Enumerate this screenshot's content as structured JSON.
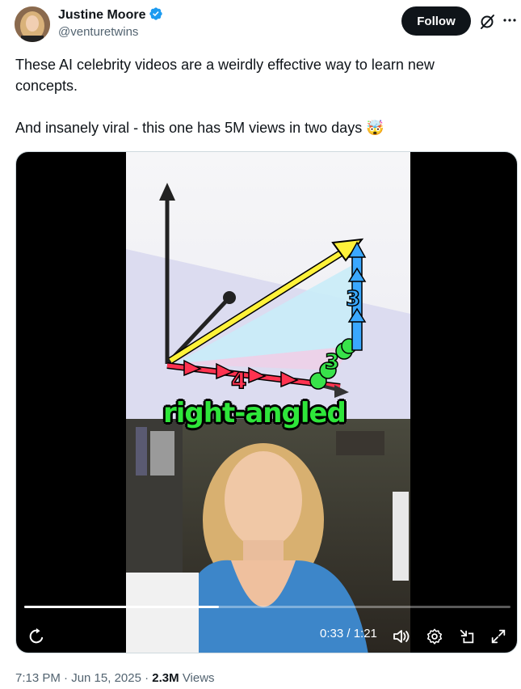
{
  "author": {
    "name": "Justine Moore",
    "handle": "@venturetwins",
    "verified_color": "#1d9bf0"
  },
  "actions": {
    "follow_label": "Follow",
    "grok_icon": "grok-icon",
    "more_icon": "more-icon"
  },
  "tweet": {
    "line1": "These AI celebrity videos are a weirdly effective way to learn new concepts.",
    "line2": "And insanely viral - this one has 5M views in two days 🤯"
  },
  "video": {
    "caption": "right-angled",
    "labels": {
      "red": "4",
      "green": "3",
      "blue": "3"
    },
    "time": "0:33 / 1:21",
    "progress": 0.4,
    "controls": [
      "replay-icon",
      "volume-icon",
      "settings-icon",
      "minimize-icon",
      "fullscreen-icon"
    ]
  },
  "meta": {
    "time": "7:13 PM · Jun 15, 2025",
    "separator": " · ",
    "views": "2.3M",
    "views_label": "Views"
  }
}
